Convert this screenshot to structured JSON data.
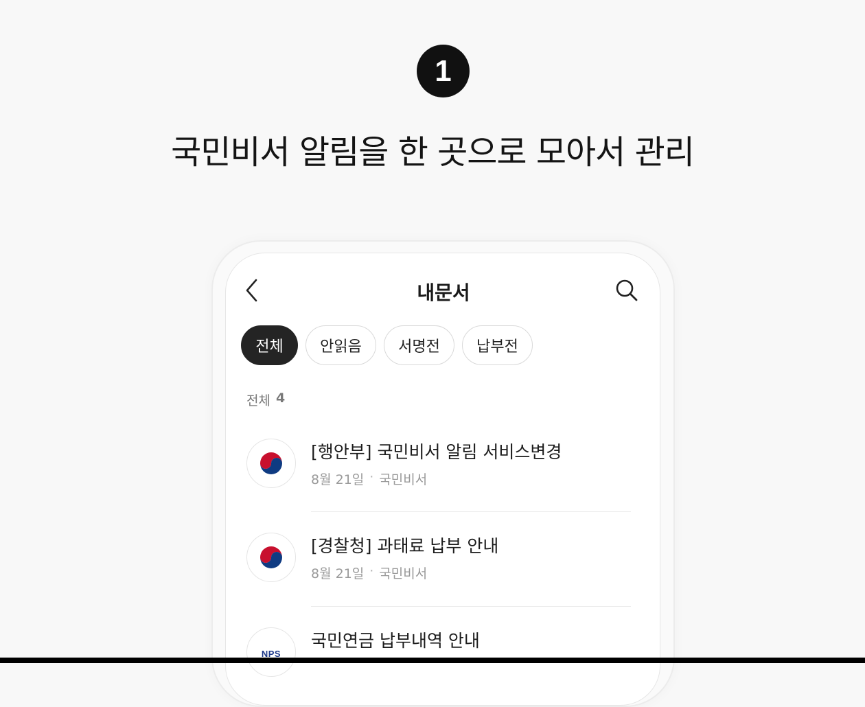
{
  "step": {
    "number": "1"
  },
  "headline": "국민비서 알림을 한 곳으로 모아서 관리",
  "screen": {
    "title": "내문서",
    "back_icon": "chevron-left-icon",
    "search_icon": "search-icon"
  },
  "filters": [
    {
      "label": "전체",
      "active": true
    },
    {
      "label": "안읽음",
      "active": false
    },
    {
      "label": "서명전",
      "active": false
    },
    {
      "label": "납부전",
      "active": false
    }
  ],
  "summary": {
    "label": "전체",
    "count": "4"
  },
  "documents": [
    {
      "title": "[행안부] 국민비서 알림 서비스변경",
      "date": "8월 21일",
      "separator": "·",
      "source": "국민비서",
      "logo": "korea-government-emblem-icon"
    },
    {
      "title": "[경찰청] 과태료 납부 안내",
      "date": "8월 21일",
      "separator": "·",
      "source": "국민비서",
      "logo": "korea-government-emblem-icon"
    },
    {
      "title": "국민연금 납부내역 안내",
      "logo_text": "NPS",
      "logo": "nps-logo-icon"
    }
  ],
  "colors": {
    "background": "#f8f8f8",
    "chip_active": "#242424",
    "emblem_red": "#c8102e",
    "emblem_blue": "#0f3b82"
  }
}
